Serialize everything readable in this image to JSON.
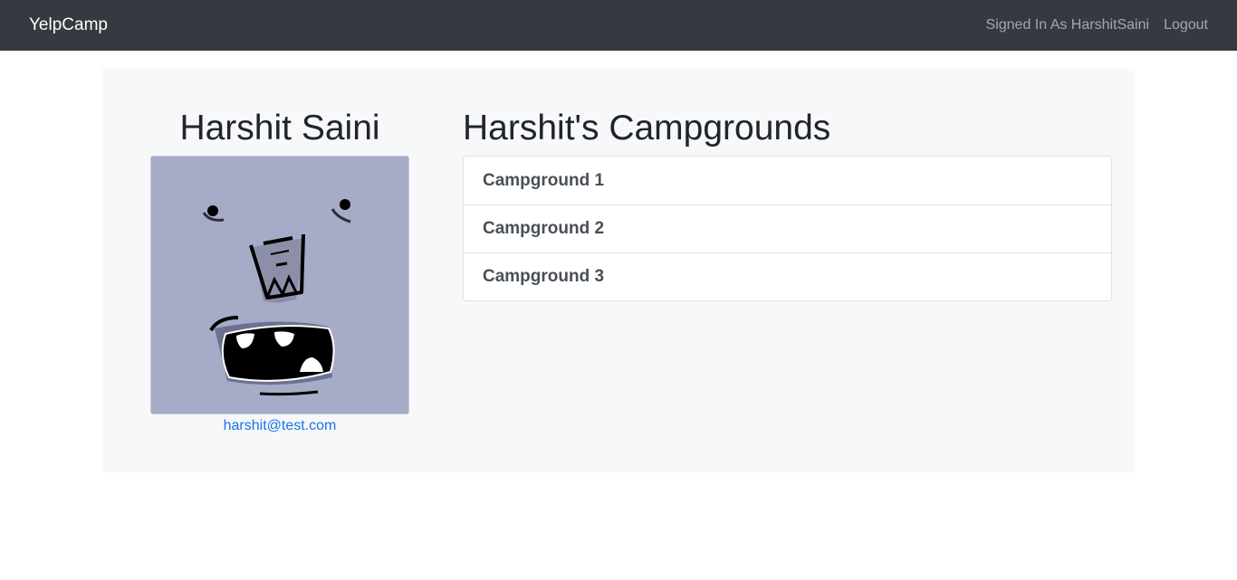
{
  "navbar": {
    "brand": "YelpCamp",
    "signed_in_text": "Signed In As HarshitSaini",
    "logout_label": "Logout"
  },
  "profile": {
    "name": "Harshit Saini",
    "email": "harshit@test.com",
    "avatar_icon": "avatar-face-icon"
  },
  "campgrounds": {
    "heading": "Harshit's Campgrounds",
    "items": [
      {
        "label": "Campground 1"
      },
      {
        "label": "Campground 2"
      },
      {
        "label": "Campground 3"
      }
    ]
  },
  "colors": {
    "navbar_bg": "#343a40",
    "jumbotron_bg": "#f7f8fa",
    "link": "#1a73e8",
    "avatar_bg": "#a6abc7"
  }
}
